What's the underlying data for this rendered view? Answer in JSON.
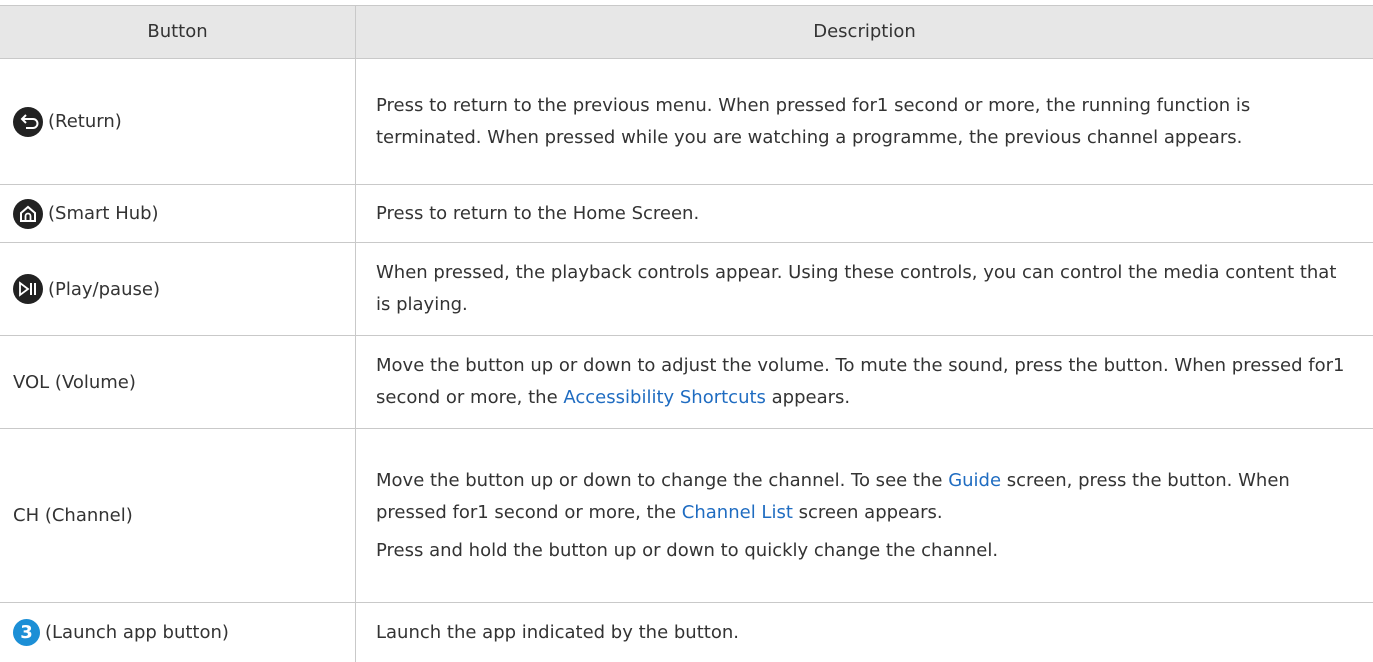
{
  "header": {
    "col_button": "Button",
    "col_description": "Description"
  },
  "rows": [
    {
      "icon": "return-icon",
      "label": "(Return)",
      "desc": [
        "Press to return to the previous menu. When pressed for1 second or more, the running function is terminated. When pressed while you are watching a programme, the previous channel appears."
      ]
    },
    {
      "icon": "home-icon",
      "label": "(Smart Hub)",
      "desc": [
        "Press to return to the Home Screen."
      ]
    },
    {
      "icon": "play-pause-icon",
      "label": "(Play/pause)",
      "desc": [
        "When pressed, the playback controls appear. Using these controls, you can control the media content that is playing."
      ]
    },
    {
      "label": "VOL (Volume)",
      "desc_parts": {
        "a": "Move the button up or down to adjust the volume. To mute the sound, press the button. When pressed for1 second or more, the ",
        "link": "Accessibility Shortcuts",
        "b": " appears."
      }
    },
    {
      "label": "CH (Channel)",
      "desc_parts": {
        "a": "Move the button up or down to change the channel. To see the ",
        "link1": "Guide",
        "b": " screen, press the button. When pressed for1 second or more, the ",
        "link2": "Channel List",
        "c": " screen appears.",
        "second": "Press and hold the button up or down to quickly change the channel."
      }
    },
    {
      "icon": "number-3-icon",
      "icon_text": "3",
      "label": "(Launch app button)",
      "desc": [
        "Launch the app indicated by the button."
      ]
    }
  ],
  "colors": {
    "header_bg": "#e7e7e7",
    "border": "#c9c9c9",
    "link": "#1f6cc1",
    "icon_dark": "#222222",
    "icon_blue": "#1c8fd6"
  }
}
